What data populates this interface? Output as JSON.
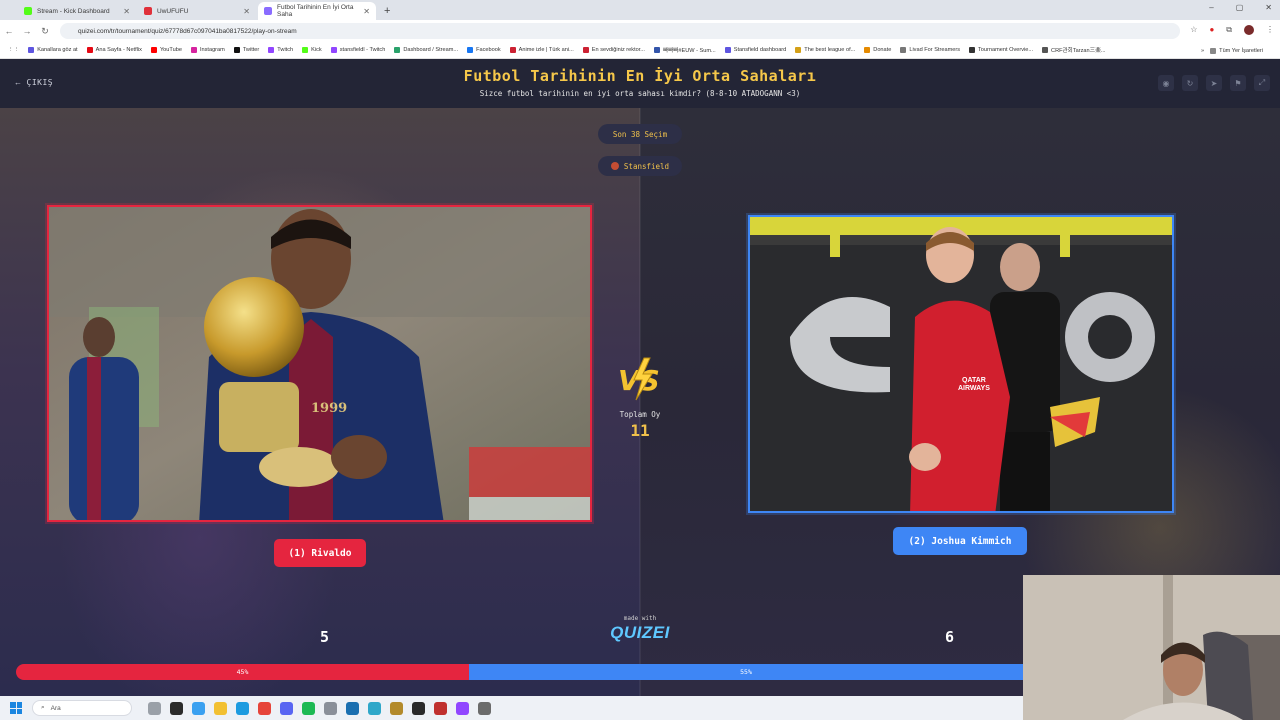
{
  "browser": {
    "tabs": [
      {
        "label": "Stream - Kick Dashboard",
        "color": "#53fc18"
      },
      {
        "label": "UwUFUFU",
        "color": "#e0303a"
      },
      {
        "label": "Futbol Tarihinin En İyi Orta Saha",
        "color": "#8a6cff"
      }
    ],
    "url": "quizei.com/tr/tournament/quiz/67778d67c097041ba0817522/play-on-stream",
    "bookmarks": [
      {
        "label": "Kanallara göz at",
        "color": "#5e55e0"
      },
      {
        "label": "Ana Sayfa - Netflix",
        "color": "#e50914"
      },
      {
        "label": "YouTube",
        "color": "#ff0000"
      },
      {
        "label": "Instagram",
        "color": "#d6249f"
      },
      {
        "label": "Twitter",
        "color": "#111111"
      },
      {
        "label": "Twitch",
        "color": "#9146ff"
      },
      {
        "label": "Kick",
        "color": "#53fc18"
      },
      {
        "label": "stansfieldl - Twitch",
        "color": "#9146ff"
      },
      {
        "label": "Dashboard / Stream...",
        "color": "#2aa26b"
      },
      {
        "label": "Facebook",
        "color": "#1877f2"
      },
      {
        "label": "Anime izle | Türk ani...",
        "color": "#cc2233"
      },
      {
        "label": "En sevdiğiniz rektor...",
        "color": "#cc2233"
      },
      {
        "label": "빠빠빠#EUW - Sum...",
        "color": "#3355aa"
      },
      {
        "label": "Stansfield dashboard",
        "color": "#5e55e0"
      },
      {
        "label": "The best league of...",
        "color": "#d4a017"
      },
      {
        "label": "Donate",
        "color": "#e58a00"
      },
      {
        "label": "Livad For Streamers",
        "color": "#777777"
      },
      {
        "label": "Tournament Overvie...",
        "color": "#333333"
      },
      {
        "label": "CRF관회Tarzan三楽...",
        "color": "#555555"
      }
    ],
    "all_bookmarks": "Tüm Yer İşaretleri"
  },
  "header": {
    "back_label": "ÇIKIŞ",
    "title": "Futbol Tarihinin En İyi Orta Sahaları",
    "subtitle": "Sizce futbol tarihinin en iyi orta sahası kimdir? (8-8-10 ATADOGANN <3)"
  },
  "game": {
    "round_label": "Son 38 Seçim",
    "streamer": "Stansfield",
    "vs_label": "VS",
    "total_votes_label": "Toplam Oy",
    "total_votes": "11",
    "left": {
      "name": "(1) Rivaldo",
      "votes": "5",
      "percent_label": "45%",
      "percent": 45
    },
    "right": {
      "name": "(2) Joshua Kimmich",
      "votes": "6",
      "percent_label": "55%",
      "percent": 55
    },
    "made_with": "made with",
    "brand": "QUIZEI"
  },
  "taskbar": {
    "search_placeholder": "Ara"
  },
  "colors": {
    "left_accent": "#e5253f",
    "right_accent": "#3e86f5",
    "title_gold": "#f6c84a"
  }
}
